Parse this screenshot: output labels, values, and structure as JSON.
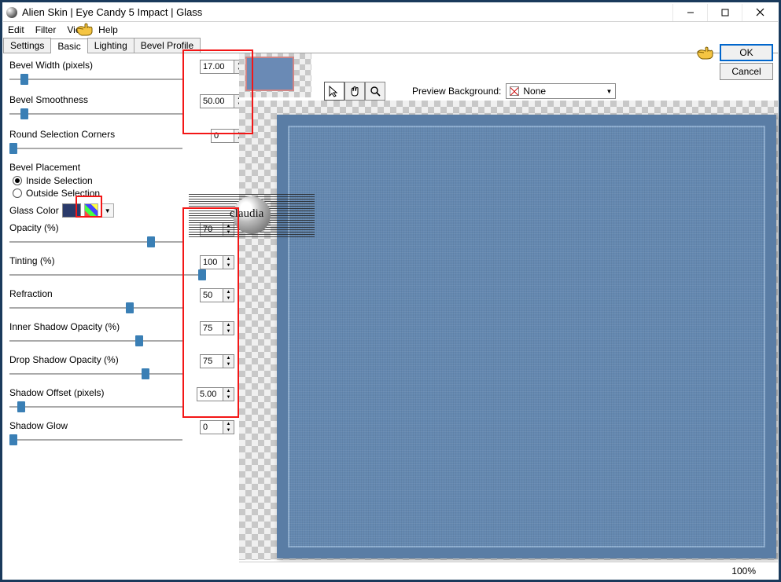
{
  "window": {
    "title": "Alien Skin | Eye Candy 5 Impact | Glass"
  },
  "menu": {
    "edit": "Edit",
    "filter": "Filter",
    "view": "View",
    "help": "Help"
  },
  "tabs": {
    "settings": "Settings",
    "basic": "Basic",
    "lighting": "Lighting",
    "bevel_profile": "Bevel Profile"
  },
  "buttons": {
    "ok": "OK",
    "cancel": "Cancel"
  },
  "params": {
    "bevel_width": {
      "label": "Bevel Width (pixels)",
      "value": "17.00"
    },
    "bevel_smoothness": {
      "label": "Bevel Smoothness",
      "value": "50.00"
    },
    "round_corners": {
      "label": "Round Selection Corners",
      "value": "0"
    },
    "bevel_placement": {
      "label": "Bevel Placement",
      "inside": "Inside Selection",
      "outside": "Outside Selection"
    },
    "glass_color": {
      "label": "Glass Color"
    },
    "opacity": {
      "label": "Opacity (%)",
      "value": "70"
    },
    "tinting": {
      "label": "Tinting (%)",
      "value": "100"
    },
    "refraction": {
      "label": "Refraction",
      "value": "50"
    },
    "inner_shadow": {
      "label": "Inner Shadow Opacity (%)",
      "value": "75"
    },
    "drop_shadow": {
      "label": "Drop Shadow Opacity (%)",
      "value": "75"
    },
    "shadow_offset": {
      "label": "Shadow Offset (pixels)",
      "value": "5.00"
    },
    "shadow_glow": {
      "label": "Shadow Glow",
      "value": "0"
    }
  },
  "preview": {
    "bg_label": "Preview Background:",
    "bg_value": "None"
  },
  "watermark": "claudia",
  "status": {
    "zoom": "100%"
  }
}
